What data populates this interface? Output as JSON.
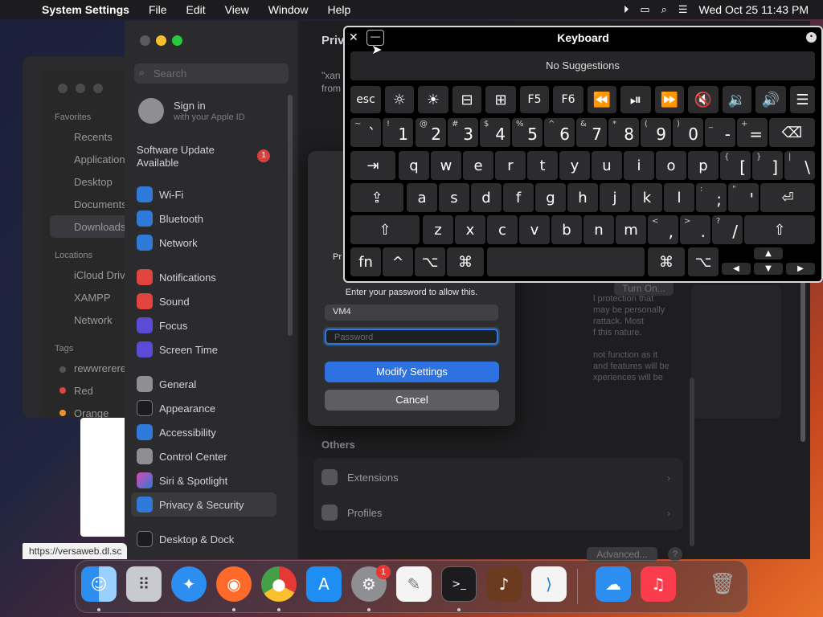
{
  "menubar": {
    "app_name": "System Settings",
    "menus": [
      "File",
      "Edit",
      "View",
      "Window",
      "Help"
    ],
    "datetime": "Wed Oct 25  11:43 PM",
    "apple_glyph": ""
  },
  "finder": {
    "favorites_header": "Favorites",
    "favorites": [
      "Recents",
      "Applications",
      "Desktop",
      "Documents",
      "Downloads"
    ],
    "locations_header": "Locations",
    "locations": [
      "iCloud Drive",
      "XAMPP",
      "Network"
    ],
    "tags_header": "Tags",
    "tags": [
      {
        "label": "rewwrerere",
        "color": "#555555"
      },
      {
        "label": "Red",
        "color": "#e0443c"
      },
      {
        "label": "Orange",
        "color": "#f0922e"
      }
    ]
  },
  "settings": {
    "search_placeholder": "Search",
    "signin_title": "Sign in",
    "signin_subtitle": "with your Apple ID",
    "update_line1": "Software Update",
    "update_line2": "Available",
    "update_badge": "1",
    "sidebar": [
      {
        "label": "Wi-Fi",
        "color": "#2f7ad8"
      },
      {
        "label": "Bluetooth",
        "color": "#2f7ad8"
      },
      {
        "label": "Network",
        "color": "#2f7ad8"
      },
      {
        "label": "Notifications",
        "color": "#e0443c"
      },
      {
        "label": "Sound",
        "color": "#e0443c"
      },
      {
        "label": "Focus",
        "color": "#5b4bd6"
      },
      {
        "label": "Screen Time",
        "color": "#5b4bd6"
      },
      {
        "label": "General",
        "color": "#8e8e93"
      },
      {
        "label": "Appearance",
        "color": "#2c2c2e"
      },
      {
        "label": "Accessibility",
        "color": "#2f7ad8"
      },
      {
        "label": "Control Center",
        "color": "#8e8e93"
      },
      {
        "label": "Siri & Spotlight",
        "color": "#b04ad8"
      },
      {
        "label": "Privacy & Security",
        "color": "#2f7ad8"
      },
      {
        "label": "Desktop & Dock",
        "color": "#2c2c2e"
      }
    ],
    "pane_title": "Priv",
    "pane_quote": "\"xan",
    "pane_from": "from",
    "others_label": "Others",
    "others": [
      "Extensions",
      "Profiles"
    ],
    "advanced_button": "Advanced...",
    "help_button": "?",
    "turn_on_button": "Turn On...",
    "bg_text": [
      "l protection that",
      "may be personally",
      "rattack. Most",
      "f this nature.",
      "not function as it",
      "and features will be",
      "xperiences will be"
    ]
  },
  "dialog": {
    "prefix": "Pr",
    "message": "Enter your password to allow this.",
    "username": "VM4",
    "password_placeholder": "Password",
    "primary_button": "Modify Settings",
    "cancel_button": "Cancel"
  },
  "keyboard": {
    "title": "Keyboard",
    "close": "✕",
    "minimize": "—",
    "suggestions": "No Suggestions",
    "more": "•••"
  },
  "status_url": "https://versaweb.dl.sc",
  "dock_badge": "1"
}
